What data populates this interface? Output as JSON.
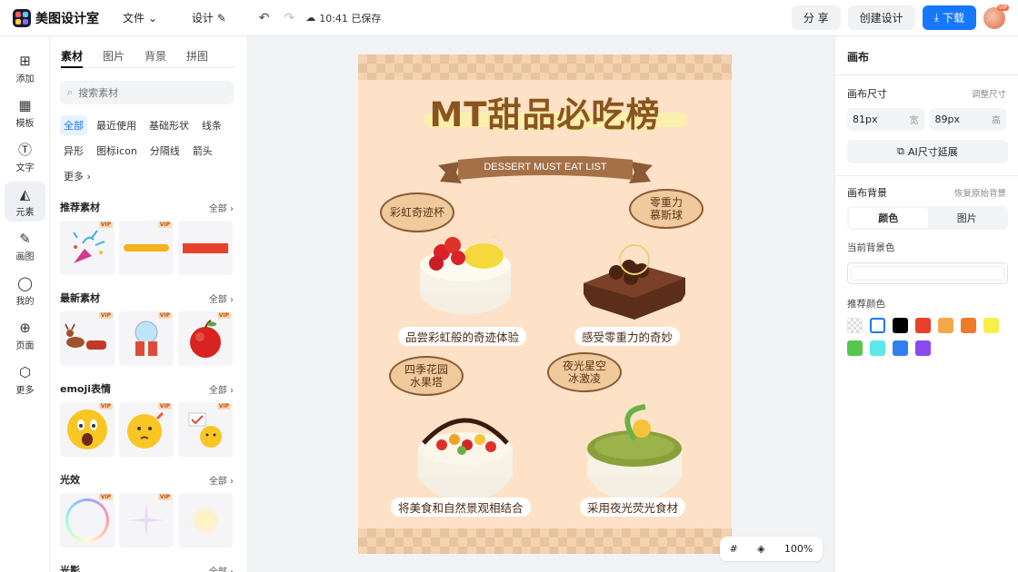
{
  "app": {
    "name": "美图设计室"
  },
  "topbar": {
    "menu_file": "文件 ⌄",
    "menu_design": "设计 ✎",
    "save_status": "10:41 已保存",
    "share": "分 享",
    "create_design": "创建设计",
    "download": "下载",
    "avatar_badge": "VIP"
  },
  "leftnav": {
    "items": [
      {
        "label": "添加",
        "icon": "add-icon"
      },
      {
        "label": "模板",
        "icon": "template-icon"
      },
      {
        "label": "文字",
        "icon": "text-icon"
      },
      {
        "label": "元素",
        "icon": "element-icon"
      },
      {
        "label": "画图",
        "icon": "draw-icon"
      },
      {
        "label": "我的",
        "icon": "user-icon"
      },
      {
        "label": "页面",
        "icon": "page-icon"
      },
      {
        "label": "更多",
        "icon": "more-icon"
      }
    ]
  },
  "panel": {
    "tabs": [
      "素材",
      "图片",
      "背景",
      "拼图"
    ],
    "search_placeholder": "搜索素材",
    "chips": [
      "全部",
      "最近使用",
      "基础形状",
      "线条",
      "异形",
      "图标icon",
      "分隔线",
      "箭头",
      "更多 ›"
    ],
    "all_label": "全部 ›",
    "sections": {
      "recommended": "推荐素材",
      "latest": "最新素材",
      "emoji": "emoji表情",
      "light": "光效",
      "shadow": "光影"
    },
    "vip": "VIP"
  },
  "poster": {
    "title": "MT甜品必吃榜",
    "subtitle": "DESSERT MUST EAT LIST",
    "items": [
      {
        "bubble": "彩虹奇迹杯",
        "caption": "品尝彩虹般的奇迹体验"
      },
      {
        "bubble": "零重力\n慕斯球",
        "caption": "感受零重力的奇妙"
      },
      {
        "bubble": "四季花园\n水果塔",
        "caption": "将美食和自然景观相结合"
      },
      {
        "bubble": "夜光星空\n冰激凌",
        "caption": "采用夜光荧光食材"
      }
    ]
  },
  "rightpanel": {
    "title": "画布",
    "size_label": "画布尺寸",
    "size_link": "调整尺寸",
    "width_value": "81px",
    "width_unit": "宽",
    "height_value": "89px",
    "height_unit": "高",
    "ai_extend": "AI尺寸延展",
    "bg_label": "画布背景",
    "bg_reset": "恢复原始背景",
    "seg_color": "颜色",
    "seg_image": "图片",
    "current_bg": "当前背景色",
    "recommended_colors": "推荐颜色",
    "swatches": [
      "transparent",
      "#ffffff",
      "#000000",
      "#e8402a",
      "#f5a84a",
      "#f07a28",
      "#f8ef48",
      "#55c84a",
      "#5ee8e8",
      "#2f7ff0",
      "#8a4af0"
    ]
  },
  "zoom": {
    "level": "100%"
  }
}
